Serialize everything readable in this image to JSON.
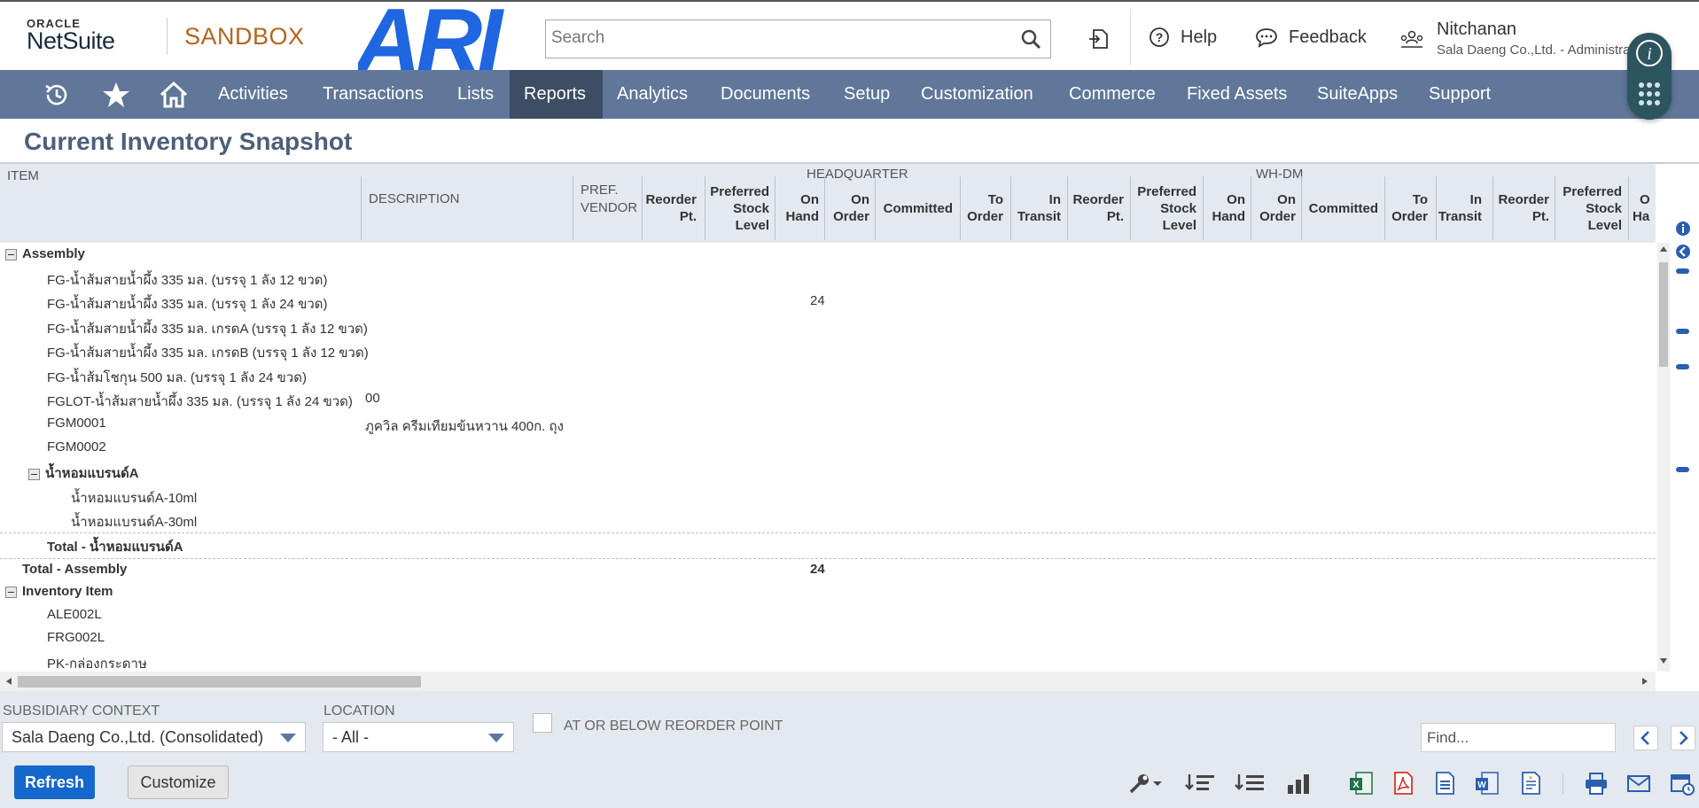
{
  "header": {
    "logo_oracle": "ORACLE",
    "logo_netsuite": "NetSuite",
    "environment": "SANDBOX",
    "brand_logo_text": "ARI",
    "search_placeholder": "Search",
    "help_label": "Help",
    "feedback_label": "Feedback",
    "user_name": "Nitchanan",
    "user_role": "Sala Daeng Co.,Ltd. - Administrator"
  },
  "nav": {
    "items": [
      "Activities",
      "Transactions",
      "Lists",
      "Reports",
      "Analytics",
      "Documents",
      "Setup",
      "Customization",
      "Commerce",
      "Fixed Assets",
      "SuiteApps",
      "Support"
    ],
    "active": "Reports"
  },
  "page": {
    "title": "Current Inventory Snapshot"
  },
  "table": {
    "col_item": "ITEM",
    "col_description": "DESCRIPTION",
    "col_pref_vendor_1": "PREF.",
    "col_pref_vendor_2": "VENDOR",
    "group_hq": "HEADQUARTER",
    "group_whdm": "WH-DM",
    "sub": {
      "reorder_1": "Reorder",
      "reorder_2": "Pt.",
      "pref_1": "Preferred",
      "pref_2": "Stock",
      "pref_3": "Level",
      "onhand_1": "On",
      "onhand_2": "Hand",
      "onorder_1": "On",
      "onorder_2": "Order",
      "committed": "Committed",
      "toorder_1": "To",
      "toorder_2": "Order",
      "intransit_1": "In",
      "intransit_2": "Transit",
      "cut_onhand_1": "O",
      "cut_onhand_2": "Ha"
    },
    "rows": [
      {
        "label": "Assembly",
        "type": "group",
        "indent": 0
      },
      {
        "label": "FG-น้ำส้มสายน้ำผึ้ง 335 มล. (บรรจุ 1 ลัง 12 ขวด)",
        "indent": 1
      },
      {
        "label": "FG-น้ำส้มสายน้ำผึ้ง 335 มล. (บรรจุ 1 ลัง 24 ขวด)",
        "indent": 1,
        "hq_onhand": "24"
      },
      {
        "label": "FG-น้ำส้มสายน้ำผึ้ง 335 มล. เกรดA (บรรจุ 1 ลัง 12 ขวด)",
        "indent": 1
      },
      {
        "label": "FG-น้ำส้มสายน้ำผึ้ง 335 มล. เกรดB (บรรจุ 1 ลัง 12 ขวด)",
        "indent": 1
      },
      {
        "label": "FG-น้ำส้มโชกุน 500 มล. (บรรจุ 1 ลัง 24 ขวด)",
        "indent": 1
      },
      {
        "label": "FGLOT-น้ำส้มสายน้ำผึ้ง 335 มล. (บรรจุ 1 ลัง 24 ขวด)",
        "indent": 1,
        "description": "00"
      },
      {
        "label": "FGM0001",
        "indent": 1,
        "description": "ภูควิล ครีมเทียมข้นหวาน 400ก. ถุง"
      },
      {
        "label": "FGM0002",
        "indent": 1
      },
      {
        "label": "น้ำหอมแบรนด์A",
        "type": "subgroup",
        "indent": 1
      },
      {
        "label": "น้ำหอมแบรนด์A-10ml",
        "indent": 2
      },
      {
        "label": "น้ำหอมแบรนด์A-30ml",
        "indent": 2
      },
      {
        "label": "Total - น้ำหอมแบรนด์A",
        "type": "subtotal",
        "indent": 1
      },
      {
        "label": "Total - Assembly",
        "type": "total",
        "indent": 0,
        "hq_onhand": "24"
      },
      {
        "label": "Inventory Item",
        "type": "group",
        "indent": 0
      },
      {
        "label": "ALE002L",
        "indent": 1
      },
      {
        "label": "FRG002L",
        "indent": 1
      },
      {
        "label": "PK-กล่องกระดาษ",
        "indent": 1
      }
    ]
  },
  "filters": {
    "subsidiary_label": "SUBSIDIARY CONTEXT",
    "subsidiary_value": "Sala Daeng Co.,Ltd. (Consolidated)",
    "location_label": "LOCATION",
    "location_value": "- All -",
    "reorder_label": "AT OR BELOW REORDER POINT",
    "find_placeholder": "Find..."
  },
  "buttons": {
    "refresh": "Refresh",
    "customize": "Customize"
  },
  "colors": {
    "nav_bg": "#607799",
    "nav_active": "#3d4d63",
    "title": "#4d5f79",
    "sandbox": "#b5651d",
    "refresh_bg": "#1467cc",
    "ari_logo": "#1f66e0"
  }
}
